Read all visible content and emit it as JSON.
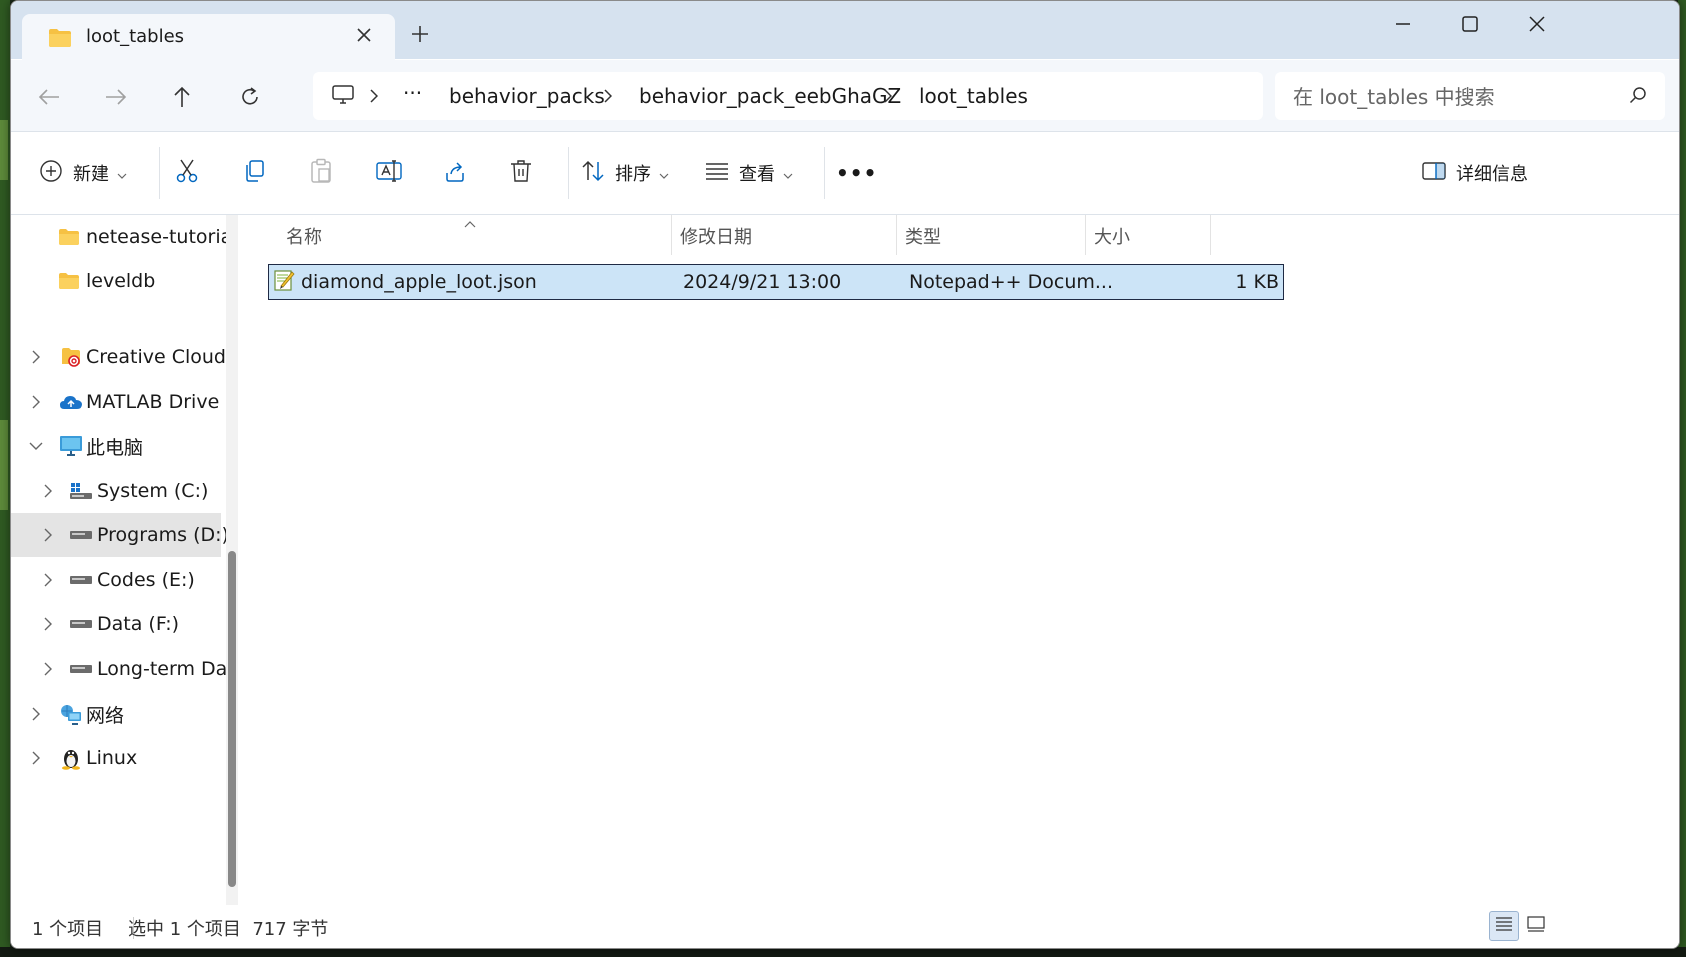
{
  "window": {
    "tab_title": "loot_tables",
    "tab_icon": "folder-icon"
  },
  "nav": {
    "breadcrumb": [
      "behavior_packs",
      "behavior_pack_eebGhaGZ",
      "loot_tables"
    ],
    "overflow": "···",
    "search_placeholder": "在 loot_tables 中搜索"
  },
  "toolbar": {
    "new_label": "新建",
    "sort_label": "排序",
    "view_label": "查看",
    "more_label": "•••",
    "details_label": "详细信息"
  },
  "sidebar": {
    "items": [
      {
        "label": "netease-tutoria",
        "icon": "folder-icon"
      },
      {
        "label": "leveldb",
        "icon": "folder-icon"
      },
      {
        "label": "Creative Cloud",
        "icon": "creative-cloud-icon"
      },
      {
        "label": "MATLAB Drive",
        "icon": "cloud-icon"
      },
      {
        "label": "此电脑",
        "icon": "computer-icon"
      },
      {
        "label": "System (C:)",
        "icon": "drive-icon"
      },
      {
        "label": "Programs (D:)",
        "icon": "drive-icon"
      },
      {
        "label": "Codes (E:)",
        "icon": "drive-icon"
      },
      {
        "label": "Data (F:)",
        "icon": "drive-icon"
      },
      {
        "label": "Long-term Da",
        "icon": "drive-icon"
      },
      {
        "label": "网络",
        "icon": "network-icon"
      },
      {
        "label": "Linux",
        "icon": "linux-icon"
      }
    ]
  },
  "files": {
    "columns": [
      "名称",
      "修改日期",
      "类型",
      "大小"
    ],
    "rows": [
      {
        "name": "diamond_apple_loot.json",
        "modified": "2024/9/21 13:00",
        "type": "Notepad++ Docum...",
        "size": "1 KB"
      }
    ]
  },
  "status": {
    "count": "1 个项目",
    "selection": "选中 1 个项目  717 字节"
  },
  "colors": {
    "accent": "#0067c0",
    "selection": "#cce4f7",
    "folder": "#f6c143"
  }
}
